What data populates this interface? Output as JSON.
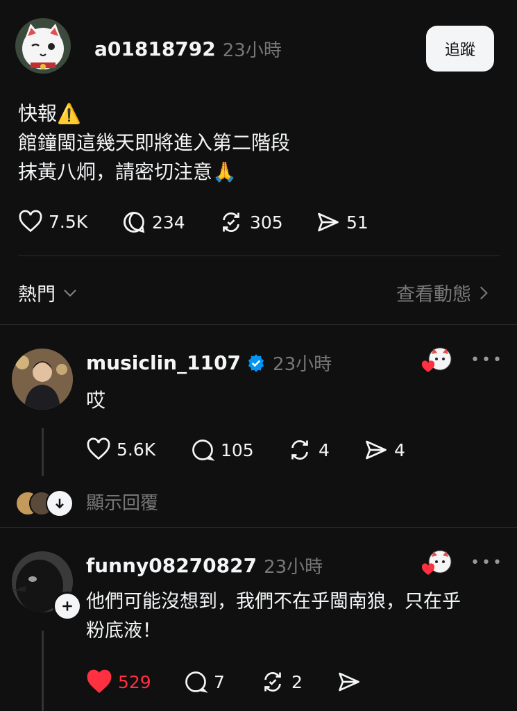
{
  "post": {
    "username": "a01818792",
    "time": "23小時",
    "follow_label": "追蹤",
    "lines": [
      "快報",
      "館鐘閩這幾天即將進入第二階段",
      "抹黃八炯，請密切注意"
    ],
    "emoji_warning": "⚠️",
    "emoji_pray": "🙏",
    "likes": "7.5K",
    "comments": "234",
    "reposts": "305",
    "shares": "51"
  },
  "sort": {
    "label": "熱門",
    "activity_link": "查看動態"
  },
  "replies": [
    {
      "username": "musiclin_1107",
      "verified": true,
      "time": "23小時",
      "text": "哎",
      "likes": "5.6K",
      "comments": "105",
      "reposts": "4",
      "shares": "4",
      "show_replies": "顯示回覆"
    },
    {
      "username": "funny08270827",
      "time": "23小時",
      "text_line1": "他們可能沒想到，我們不在乎閩南狼，只在乎",
      "text_line2": "粉底液！",
      "likes": "529",
      "comments": "7",
      "reposts": "2",
      "liked": true
    }
  ],
  "colors": {
    "background": "#101010",
    "text": "#f3f5f7",
    "muted": "#777777",
    "liked_red": "#ff3040",
    "verified_blue": "#0095f6"
  }
}
